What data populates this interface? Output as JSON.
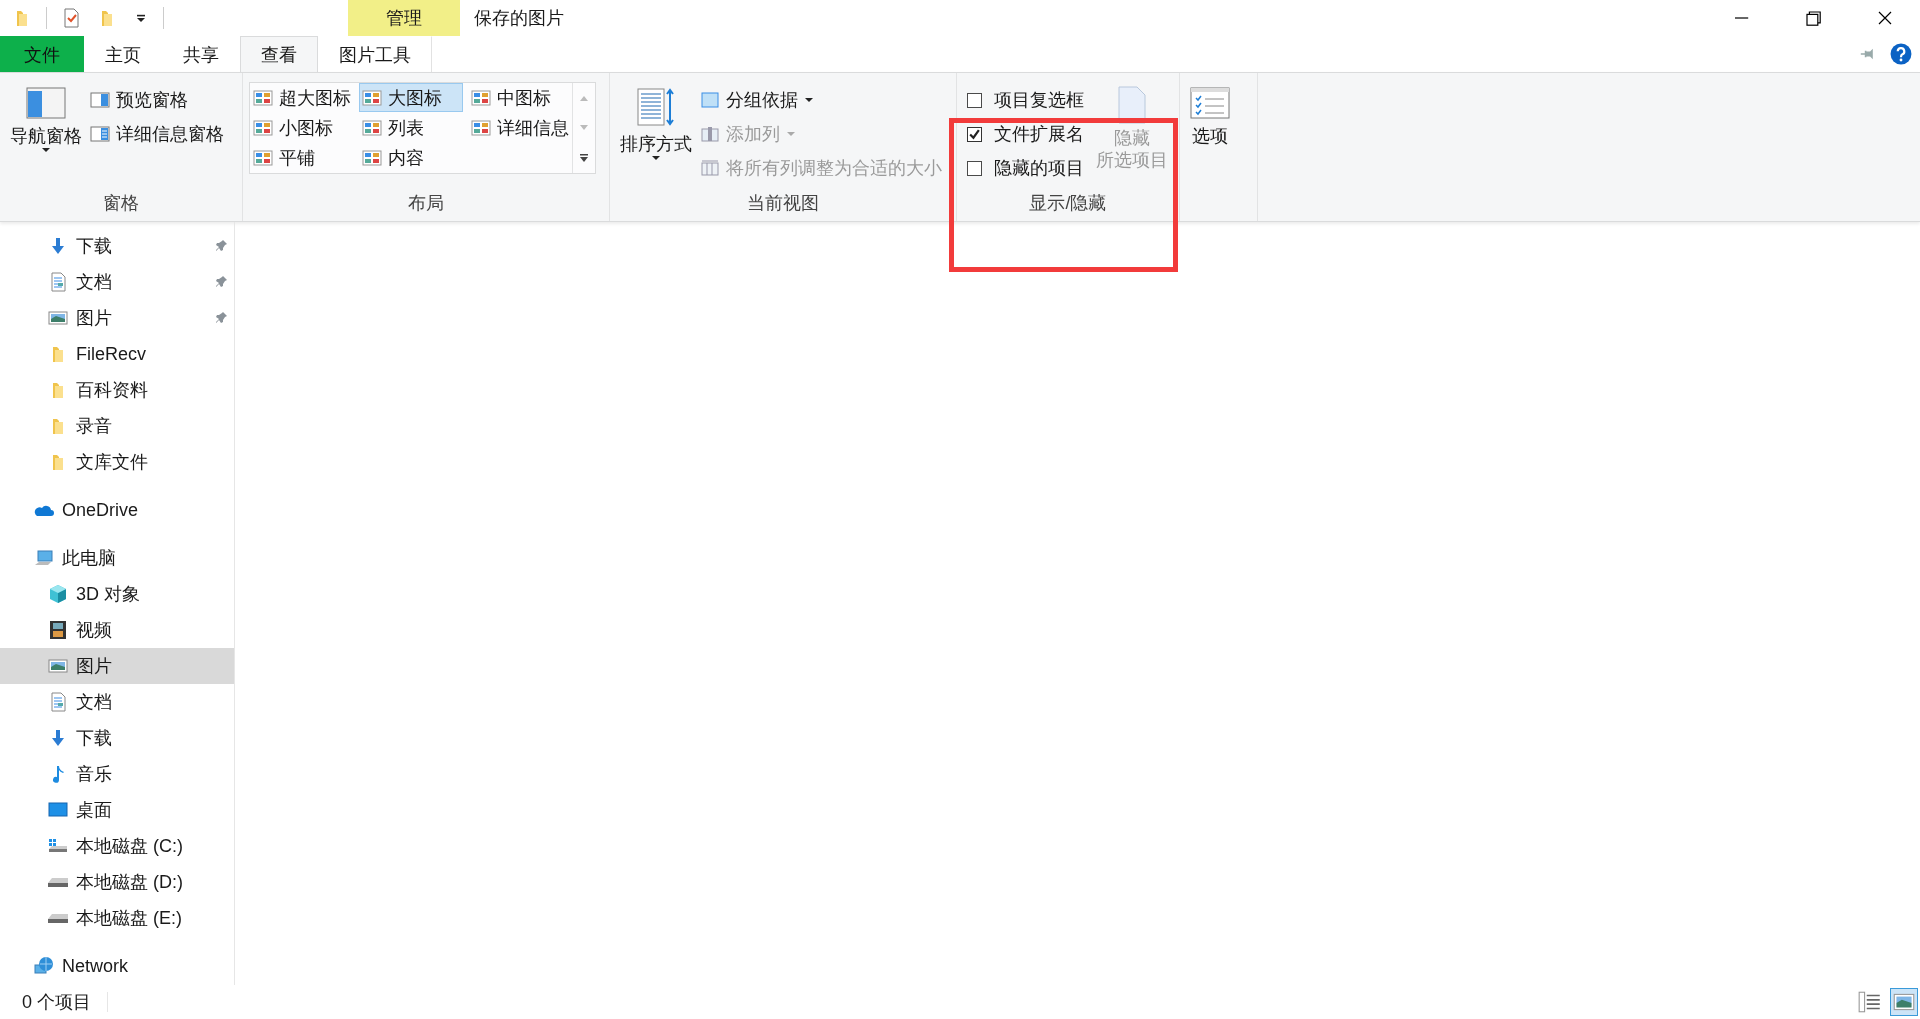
{
  "window": {
    "title": "保存的图片",
    "context_header": "管理"
  },
  "ribbon_tabs": [
    {
      "label": "文件",
      "kind": "file",
      "selected": false
    },
    {
      "label": "主页",
      "kind": "tab",
      "selected": false
    },
    {
      "label": "共享",
      "kind": "tab",
      "selected": false
    },
    {
      "label": "查看",
      "kind": "tab",
      "selected": true
    },
    {
      "label": "图片工具",
      "kind": "contextual",
      "selected": false
    }
  ],
  "ribbon": {
    "panes": {
      "label": "窗格",
      "navigation_pane": "导航窗格",
      "buttons": [
        "预览窗格",
        "详细信息窗格"
      ]
    },
    "layout": {
      "label": "布局",
      "options": [
        {
          "label": "超大图标",
          "selected": false
        },
        {
          "label": "大图标",
          "selected": true
        },
        {
          "label": "中图标",
          "selected": false
        },
        {
          "label": "小图标",
          "selected": false
        },
        {
          "label": "列表",
          "selected": false
        },
        {
          "label": "详细信息",
          "selected": false
        },
        {
          "label": "平铺",
          "selected": false
        },
        {
          "label": "内容",
          "selected": false
        }
      ]
    },
    "current_view": {
      "label": "当前视图",
      "sort_by": "排序方式",
      "commands": [
        {
          "label": "分组依据",
          "disabled": false,
          "dropdown": true
        },
        {
          "label": "添加列",
          "disabled": true,
          "dropdown": true
        },
        {
          "label": "将所有列调整为合适的大小",
          "disabled": true,
          "dropdown": false
        }
      ]
    },
    "show_hide": {
      "label": "显示/隐藏",
      "checkboxes": [
        {
          "label": "项目复选框",
          "checked": false
        },
        {
          "label": "文件扩展名",
          "checked": true
        },
        {
          "label": "隐藏的项目",
          "checked": false
        }
      ],
      "hide_selected": {
        "lines": [
          "隐藏",
          "所选项目"
        ],
        "disabled": true
      }
    },
    "options": {
      "label": "选项"
    }
  },
  "navigation": {
    "quick_access": [
      {
        "label": "下载",
        "kind": "download",
        "pinned": true,
        "selected": false
      },
      {
        "label": "文档",
        "kind": "document",
        "pinned": true,
        "selected": false
      },
      {
        "label": "图片",
        "kind": "picture",
        "pinned": true,
        "selected": false
      },
      {
        "label": "FileRecv",
        "kind": "folder",
        "pinned": false,
        "selected": false
      },
      {
        "label": "百科资料",
        "kind": "folder",
        "pinned": false,
        "selected": false
      },
      {
        "label": "录音",
        "kind": "folder",
        "pinned": false,
        "selected": false
      },
      {
        "label": "文库文件",
        "kind": "folder",
        "pinned": false,
        "selected": false
      }
    ],
    "roots": [
      {
        "label": "OneDrive",
        "kind": "cloud",
        "selected": false
      },
      {
        "label": "此电脑",
        "kind": "computer",
        "selected": false,
        "children": [
          {
            "label": "3D 对象",
            "kind": "cube",
            "selected": false
          },
          {
            "label": "视频",
            "kind": "film",
            "selected": false
          },
          {
            "label": "图片",
            "kind": "picture",
            "selected": true
          },
          {
            "label": "文档",
            "kind": "document",
            "selected": false
          },
          {
            "label": "下载",
            "kind": "download",
            "selected": false
          },
          {
            "label": "音乐",
            "kind": "music",
            "selected": false
          },
          {
            "label": "桌面",
            "kind": "desktop",
            "selected": false
          },
          {
            "label": "本地磁盘 (C:)",
            "kind": "drive-win",
            "selected": false
          },
          {
            "label": "本地磁盘 (D:)",
            "kind": "drive",
            "selected": false
          },
          {
            "label": "本地磁盘 (E:)",
            "kind": "drive",
            "selected": false
          }
        ]
      },
      {
        "label": "Network",
        "kind": "network",
        "selected": false
      }
    ]
  },
  "status_bar": {
    "item_count": "0 个项目",
    "views": [
      {
        "kind": "details",
        "selected": false
      },
      {
        "kind": "large-icons",
        "selected": true
      }
    ]
  },
  "annotation": {
    "kind": "frame"
  }
}
